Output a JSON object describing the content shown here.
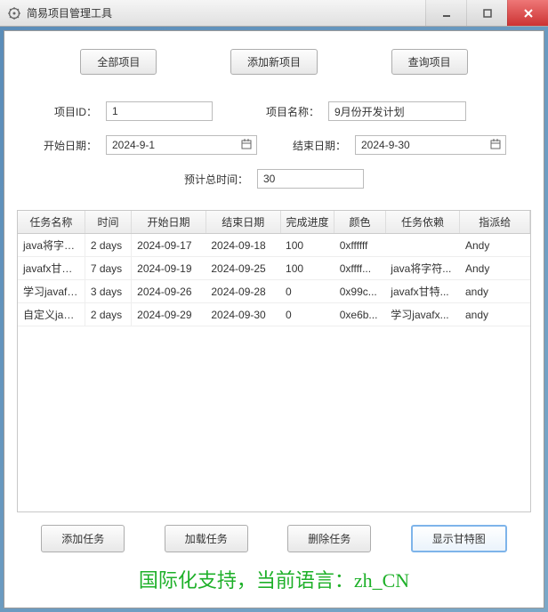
{
  "window": {
    "title": "简易项目管理工具"
  },
  "topButtons": {
    "all": "全部项目",
    "addNew": "添加新项目",
    "query": "查询项目"
  },
  "form": {
    "projectIdLabel": "项目ID：",
    "projectIdValue": "1",
    "projectNameLabel": "项目名称：",
    "projectNameValue": "9月份开发计划",
    "startDateLabel": "开始日期：",
    "startDateValue": "2024-9-1",
    "endDateLabel": "结束日期：",
    "endDateValue": "2024-9-30",
    "estTotalLabel": "预计总时间：",
    "estTotalValue": "30"
  },
  "table": {
    "headers": [
      "任务名称",
      "时间",
      "开始日期",
      "结束日期",
      "完成进度",
      "颜色",
      "任务依赖",
      "指派给"
    ],
    "rows": [
      [
        "java将字符...",
        "2 days",
        "2024-09-17",
        "2024-09-18",
        "100",
        "0xffffff",
        "",
        "Andy"
      ],
      [
        "javafx甘特...",
        "7 days",
        "2024-09-19",
        "2024-09-25",
        "100",
        "0xffff...",
        "java将字符...",
        "Andy"
      ],
      [
        "学习javafx...",
        "3 days",
        "2024-09-26",
        "2024-09-28",
        "0",
        "0x99c...",
        "javafx甘特...",
        "andy"
      ],
      [
        "自定义java...",
        "2 days",
        "2024-09-29",
        "2024-09-30",
        "0",
        "0xe6b...",
        "学习javafx...",
        "andy"
      ]
    ]
  },
  "bottomButtons": {
    "addTask": "添加任务",
    "loadTask": "加载任务",
    "deleteTask": "删除任务",
    "showGantt": "显示甘特图"
  },
  "footer": "国际化支持，当前语言：zh_CN"
}
